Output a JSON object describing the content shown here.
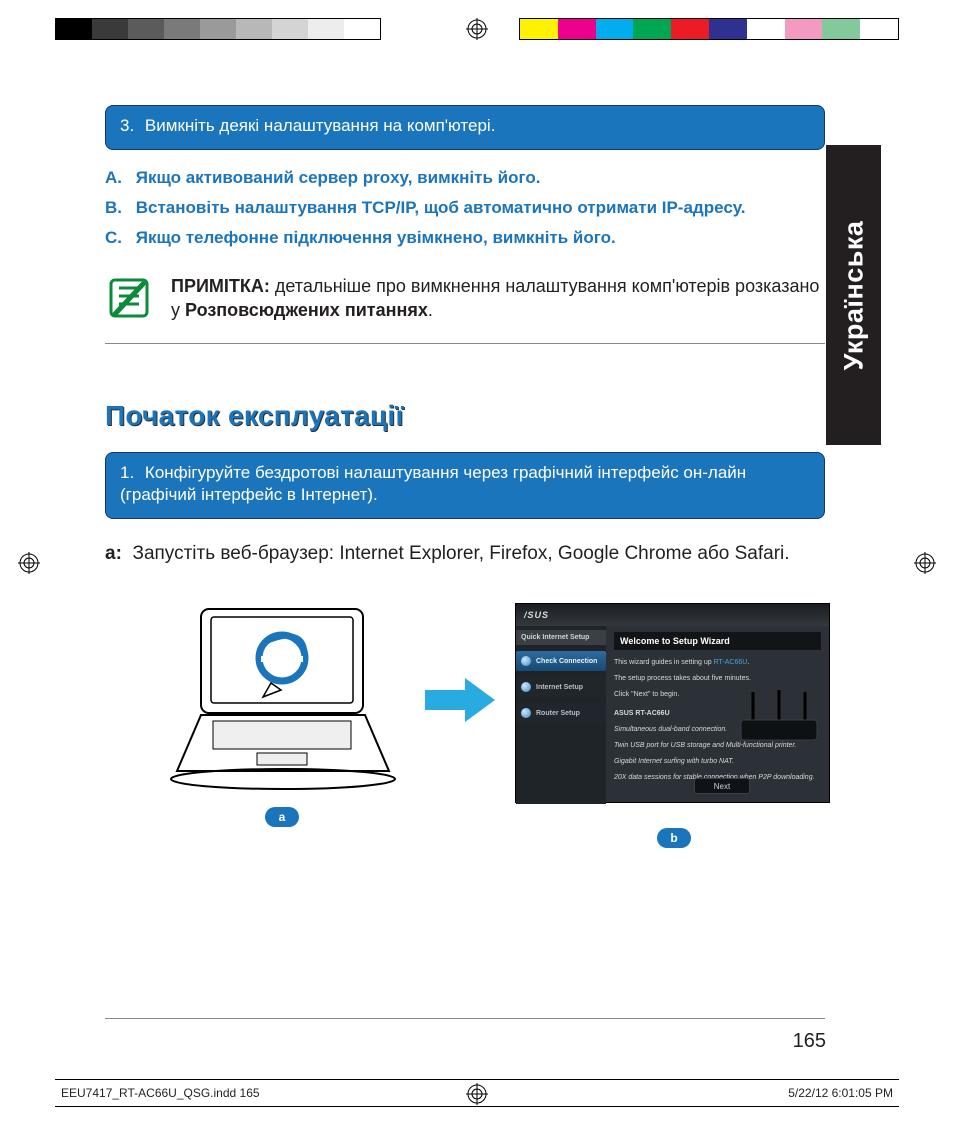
{
  "printer": {
    "reg_alt": "registration-mark"
  },
  "language_tab": "Українська",
  "step3": {
    "num": "3.",
    "text": "Вимкніть деякі налаштування на комп'ютері."
  },
  "abc": {
    "a": {
      "lbl": "A.",
      "text": "Якщо активований сервер proxy, вимкніть його."
    },
    "b": {
      "lbl": "B.",
      "text": "Встановіть налаштування TCP/IP, щоб автоматично отримати IP-адресу."
    },
    "c": {
      "lbl": "C.",
      "text": "Якщо телефонне підключення увімкнено, вимкніть його."
    }
  },
  "note": {
    "label": "ПРИМІТКА:",
    "pre": "детальніше про вимкнення налаштування комп'ютерів розказано у ",
    "bold": "Розповсюджених питаннях",
    "post": "."
  },
  "section_heading": "Початок експлуатації",
  "step1": {
    "num": "1.",
    "text": "Конфігуруйте бездротові налаштування через графічний інтерфейс он-лайн (графічий інтерфейс в Інтернет)."
  },
  "stepA": {
    "lbl": "a:",
    "text": "Запустіть веб-браузер: Internet Explorer, Firefox, Google Chrome або  Safari."
  },
  "wizard": {
    "brand": "/SUS",
    "side_header": "Quick Internet Setup",
    "side_items": [
      "Check Connection",
      "Internet Setup",
      "Router Setup"
    ],
    "title": "Welcome to Setup Wizard",
    "l1": "This wizard guides in setting up ",
    "l1_model": "RT-AC66U",
    "l2": "The setup process takes about five minutes.",
    "l3": "Click \"Next\" to begin.",
    "model_hdr": "ASUS RT-AC66U",
    "desc1": "Simultaneous dual-band connection.",
    "desc2": "Twin USB port for USB storage and Multi-functional printer.",
    "desc3": "Gigabit Internet surfing with turbo NAT.",
    "desc4": "20X data sessions for stable connection when P2P downloading.",
    "next": "Next"
  },
  "badges": {
    "a": "a",
    "b": "b"
  },
  "page_number": "165",
  "slug": {
    "file": "EEU7417_RT-AC66U_QSG.indd   165",
    "datetime": "5/22/12   6:01:05 PM"
  }
}
